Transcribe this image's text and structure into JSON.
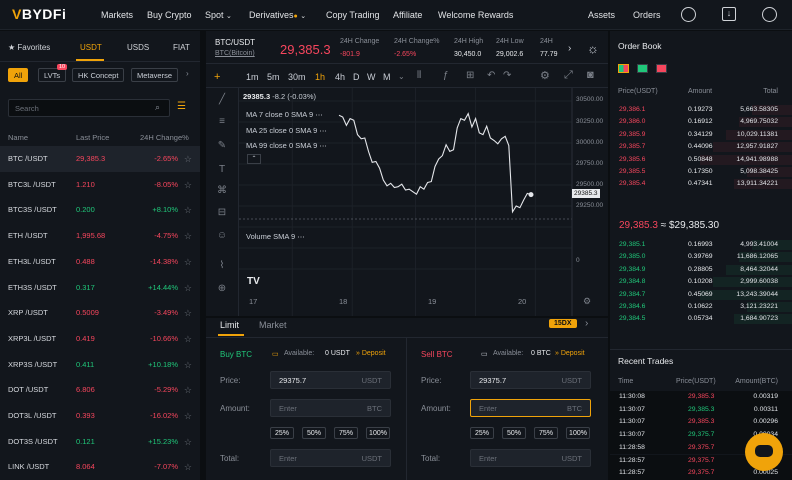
{
  "nav": {
    "logo_prefix": "V",
    "logo": "BYDFi",
    "items": [
      "Markets",
      "Buy Crypto",
      "Spot",
      "Derivatives",
      "Copy Trading",
      "Affiliate",
      "Welcome Rewards"
    ],
    "assets": "Assets",
    "orders": "Orders"
  },
  "left": {
    "tabs": [
      "Favorites",
      "USDT",
      "USDS",
      "FIAT"
    ],
    "chips": [
      "All",
      "LVTs",
      "HK Concept",
      "Metaverse"
    ],
    "chip_badge": "10",
    "search_placeholder": "Search",
    "headers": [
      "Name",
      "Last Price",
      "24H Change%"
    ],
    "pairs": [
      {
        "s": "BTC /USDT",
        "p": "29,385.3",
        "c": "-2.65%",
        "d": "down"
      },
      {
        "s": "BTC3L /USDT",
        "p": "1.210",
        "c": "-8.05%",
        "d": "down"
      },
      {
        "s": "BTC3S /USDT",
        "p": "0.200",
        "c": "+8.10%",
        "d": "up"
      },
      {
        "s": "ETH /USDT",
        "p": "1,995.68",
        "c": "-4.75%",
        "d": "down"
      },
      {
        "s": "ETH3L /USDT",
        "p": "0.488",
        "c": "-14.38%",
        "d": "down"
      },
      {
        "s": "ETH3S /USDT",
        "p": "0.317",
        "c": "+14.44%",
        "d": "up"
      },
      {
        "s": "XRP /USDT",
        "p": "0.5009",
        "c": "-3.49%",
        "d": "down"
      },
      {
        "s": "XRP3L /USDT",
        "p": "0.419",
        "c": "-10.66%",
        "d": "down"
      },
      {
        "s": "XRP3S /USDT",
        "p": "0.411",
        "c": "+10.18%",
        "d": "up"
      },
      {
        "s": "DOT /USDT",
        "p": "6.806",
        "c": "-5.29%",
        "d": "down"
      },
      {
        "s": "DOT3L /USDT",
        "p": "0.393",
        "c": "-16.02%",
        "d": "down"
      },
      {
        "s": "DOT3S /USDT",
        "p": "0.121",
        "c": "+15.23%",
        "d": "up"
      },
      {
        "s": "LINK /USDT",
        "p": "8.064",
        "c": "-7.07%",
        "d": "down"
      }
    ]
  },
  "ticker": {
    "pair": "BTC/USDT",
    "sub": "BTC(Bitcoin)",
    "price": "29,385.3",
    "labels": [
      "24H Change",
      "24H Change%",
      "24H High",
      "24H Low",
      "24H"
    ],
    "values": [
      "-801.9",
      "-2.65%",
      "30,450.0",
      "29,002.6",
      "77.79"
    ]
  },
  "chart": {
    "timeframes": [
      "1m",
      "5m",
      "30m",
      "1h",
      "4h",
      "D",
      "W",
      "M"
    ],
    "active_tf": "1h",
    "ohlc_label": "29",
    "ohlc_value": "385.3",
    "ohlc_change": "-8.2 (-0.03%)",
    "ma_labels": [
      "MA 7 close 0 SMA 9",
      "MA 25 close 0 SMA 9",
      "MA 99 close 0 SMA 9"
    ],
    "volume_label": "Volume SMA 9",
    "y_ticks": [
      "30500.00",
      "30250.00",
      "30000.00",
      "29750.00",
      "29500.00",
      "29250.00",
      "0"
    ],
    "x_ticks": [
      "17",
      "18",
      "19",
      "20"
    ],
    "price_tag": "29385.3",
    "line": [
      30330,
      30310,
      30210,
      30290,
      30270,
      30100,
      30050,
      30060,
      29900,
      29770,
      29780,
      29700,
      29560,
      29490,
      29520,
      29470,
      29480,
      29510,
      29440,
      29450,
      29420,
      29390,
      29480,
      29450,
      29530,
      29540,
      29720,
      29810,
      29850,
      29980,
      29900,
      29920,
      30180,
      30290,
      30270,
      30350,
      30190,
      30290,
      30120,
      30100,
      30200,
      30060,
      30030,
      29990,
      30050,
      30080,
      29970,
      29180,
      29250,
      29230,
      29320,
      29400,
      29385
    ]
  },
  "trade": {
    "tabs": [
      "Limit",
      "Market"
    ],
    "leverage": "15DX",
    "buy": {
      "title": "Buy BTC",
      "available_label": "Available:",
      "available": "0 USDT",
      "deposit": "Deposit",
      "price": "29375.7",
      "unit": "USDT",
      "amount_ph": "Enter",
      "amount_unit": "BTC",
      "total_ph": "Enter",
      "total_unit": "USDT"
    },
    "sell": {
      "title": "Sell BTC",
      "available_label": "Available:",
      "available": "0 BTC",
      "deposit": "Deposit",
      "price": "29375.7",
      "unit": "USDT",
      "amount_ph": "Enter",
      "amount_unit": "BTC",
      "total_ph": "Enter",
      "total_unit": "USDT"
    },
    "labels": {
      "price": "Price:",
      "amount": "Amount:",
      "total": "Total:"
    },
    "pcts": [
      "25%",
      "50%",
      "75%",
      "100%"
    ]
  },
  "orderbook": {
    "title": "Order Book",
    "headers": [
      "Price(USDT)",
      "Amount",
      "Total"
    ],
    "asks": [
      [
        "29,386.1",
        "0.19273",
        "5,663.58305"
      ],
      [
        "29,386.0",
        "0.16912",
        "4,969.75032"
      ],
      [
        "29,385.9",
        "0.34129",
        "10,029.11381"
      ],
      [
        "29,385.7",
        "0.44096",
        "12,957.91827"
      ],
      [
        "29,385.6",
        "0.50848",
        "14,941.98988"
      ],
      [
        "29,385.5",
        "0.17350",
        "5,098.38425"
      ],
      [
        "29,385.4",
        "0.47341",
        "13,911.34221"
      ]
    ],
    "mid_price": "29,385.3",
    "mid_usd": "≈ $29,385.30",
    "bids": [
      [
        "29,385.1",
        "0.16993",
        "4,993.41004"
      ],
      [
        "29,385.0",
        "0.39769",
        "11,686.12065"
      ],
      [
        "29,384.9",
        "0.28805",
        "8,464.32044"
      ],
      [
        "29,384.8",
        "0.10208",
        "2,999.60038"
      ],
      [
        "29,384.7",
        "0.45069",
        "13,243.39044"
      ],
      [
        "29,384.6",
        "0.10622",
        "3,121.23221"
      ],
      [
        "29,384.5",
        "0.05734",
        "1,684.90723"
      ]
    ]
  },
  "recent": {
    "title": "Recent Trades",
    "headers": [
      "Time",
      "Price(USDT)",
      "Amount(BTC)"
    ],
    "rows": [
      [
        "11:30:08",
        "29,385.3",
        "0.00319",
        "down"
      ],
      [
        "11:30:07",
        "29,385.3",
        "0.00311",
        "up"
      ],
      [
        "11:30:07",
        "29,385.3",
        "0.00296",
        "down"
      ],
      [
        "11:30:07",
        "29,375.7",
        "0.00034",
        "up"
      ],
      [
        "11:28:58",
        "29,375.7",
        "0.00048",
        "down"
      ],
      [
        "11:28:57",
        "29,375.7",
        "0.00011",
        "down"
      ],
      [
        "11:28:57",
        "29,375.7",
        "0.00025",
        "down"
      ]
    ]
  },
  "colors": {
    "accent": "#f0a30a",
    "up": "#20c77a",
    "down": "#f6465d",
    "bg": "#0b0e11",
    "panel": "#12161c"
  }
}
